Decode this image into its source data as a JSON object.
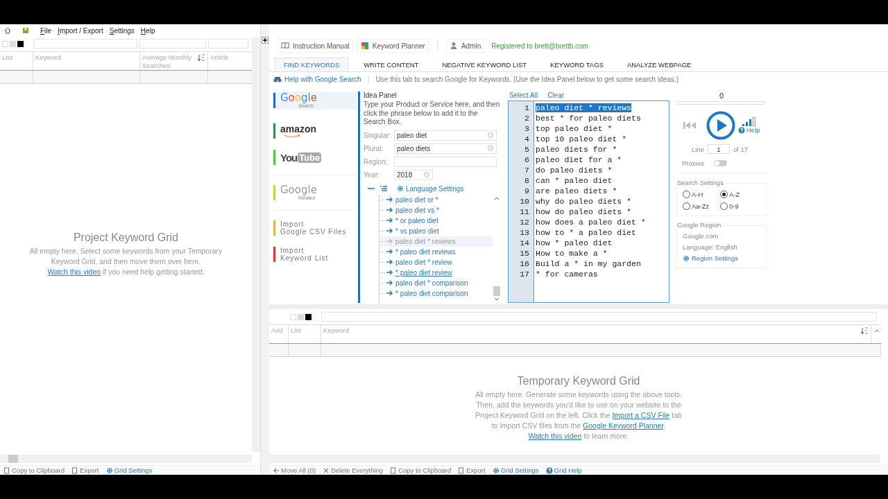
{
  "menu": [
    {
      "label": "File"
    },
    {
      "label": "Import / Export"
    },
    {
      "label": "Settings"
    },
    {
      "label": "Help"
    }
  ],
  "project_grid": {
    "columns": [
      "List",
      "Keyword",
      "Average Monthly Searches",
      "Article"
    ],
    "empty_title": "Project Keyword Grid",
    "empty_message": [
      {
        "kind": "text",
        "text": "All empty here. Select some keywords from your Temporary Keyword Grid, and then move them over here. "
      },
      {
        "kind": "link",
        "text": "Watch this video"
      },
      {
        "kind": "text",
        "text": " if you need help getting started."
      }
    ]
  },
  "project_footer": [
    {
      "label": "Copy to Clipboard",
      "kind": "plain"
    },
    {
      "label": "Export",
      "kind": "plain"
    },
    {
      "label": "Grid Settings",
      "kind": "link"
    }
  ],
  "toolbar": {
    "buttons": [
      "Instruction Manual",
      "Keyword Planner",
      "Admin"
    ],
    "registration": "Registered to brett@brettb.com"
  },
  "tabs": [
    {
      "label": "FIND KEYWORDS",
      "selected": true
    },
    {
      "label": "WRITE CONTENT",
      "selected": false
    },
    {
      "label": "NEGATIVE KEYWORD LIST",
      "selected": false
    },
    {
      "label": "KEYWORD TAGS",
      "selected": false
    },
    {
      "label": "ANALYZE WEBPAGE",
      "selected": false
    }
  ],
  "help_link": "Help with Google Search",
  "tab_hint": "Use this tab to search Google for Keywords. (Use the Idea Panel below to get some search ideas.)",
  "sources": [
    {
      "kind": "google",
      "label": "Google",
      "sublabel": "Search",
      "color": "#1e6fc4",
      "selected": true
    },
    {
      "kind": "amazon",
      "label": "amazon",
      "color": "#3c8a5a",
      "selected": false
    },
    {
      "kind": "youtube",
      "label": "You",
      "sublabel": "Tube",
      "color": "#4cc44c",
      "selected": false
    },
    {
      "kind": "related",
      "label": "Google",
      "sublabel": "Related",
      "color": "#b8d84a",
      "selected": false
    },
    {
      "kind": "import",
      "label": "Import",
      "sublabel": "Google CSV Files",
      "color": "#e8b450",
      "selected": false
    },
    {
      "kind": "import",
      "label": "Import",
      "sublabel": "Keyword List",
      "color": "#d43a3a",
      "selected": false
    }
  ],
  "idea_panel": {
    "title": "Idea Panel",
    "instructions": "Type your Product or Service here, and then click the phrase below to add it to the Search Box.",
    "fields": [
      {
        "kind": "text",
        "label": "Singular:",
        "value": "paleo diet"
      },
      {
        "kind": "text",
        "label": "Plural:",
        "value": "paleo diets"
      },
      {
        "kind": "text",
        "label": "Region:"
      },
      {
        "kind": "short",
        "label": "Year:",
        "value": "2018"
      }
    ],
    "language_settings": "Language Settings",
    "phrases": [
      {
        "text": "paleo diet or *",
        "used": false,
        "hovered": false
      },
      {
        "text": "paleo diet vs *",
        "used": false,
        "hovered": false
      },
      {
        "text": "* or paleo diet",
        "used": false,
        "hovered": false
      },
      {
        "text": "* vs paleo diet",
        "used": false,
        "hovered": false
      },
      {
        "text": "paleo diet * reviews",
        "used": true,
        "hovered": false
      },
      {
        "text": "* paleo diet reviews",
        "used": false,
        "hovered": false
      },
      {
        "text": "paleo diet * review",
        "used": false,
        "hovered": false
      },
      {
        "text": "* paleo diet review",
        "used": false,
        "hovered": true
      },
      {
        "text": "paleo diet * comparison",
        "used": false,
        "hovered": false
      },
      {
        "text": "* paleo diet comparison",
        "used": false,
        "hovered": false
      }
    ]
  },
  "keywords": {
    "select_all": "Select All",
    "clear": "Clear",
    "lines": [
      {
        "number": "1",
        "text": "paleo diet * reviews",
        "selected": true
      },
      {
        "number": "2",
        "text": "best * for paleo diets",
        "selected": false
      },
      {
        "number": "3",
        "text": "top paleo diet *",
        "selected": false
      },
      {
        "number": "4",
        "text": "top 10 paleo diet *",
        "selected": false
      },
      {
        "number": "5",
        "text": "paleo diets for *",
        "selected": false
      },
      {
        "number": "6",
        "text": "paleo diet for a *",
        "selected": false
      },
      {
        "number": "7",
        "text": "do paleo diets *",
        "selected": false
      },
      {
        "number": "8",
        "text": "can * paleo diet",
        "selected": false
      },
      {
        "number": "9",
        "text": "are paleo diets *",
        "selected": false
      },
      {
        "number": "10",
        "text": "why do paleo diets *",
        "selected": false
      },
      {
        "number": "11",
        "text": "how do paleo diets *",
        "selected": false
      },
      {
        "number": "12",
        "text": "how does a paleo diet *",
        "selected": false
      },
      {
        "number": "13",
        "text": "how to * a paleo diet",
        "selected": false
      },
      {
        "number": "14",
        "text": "how * paleo diet",
        "selected": false
      },
      {
        "number": "15",
        "text": "How to make a *",
        "selected": false
      },
      {
        "number": "16",
        "text": "Build a * in my garden",
        "selected": false
      },
      {
        "number": "17",
        "text": "* for cameras",
        "selected": false
      }
    ]
  },
  "runner": {
    "count": "0",
    "level": 0,
    "help": "Help",
    "line_label": "Line",
    "line_value": "1",
    "line_total": "of 17",
    "proxies_label": "Proxies",
    "proxies_on": false
  },
  "search_settings": {
    "title": "Search Settings",
    "options": [
      {
        "label": "A-H",
        "selected": false
      },
      {
        "label": "A-Z",
        "selected": true
      },
      {
        "label": "Aa-Zz",
        "selected": false
      },
      {
        "label": "0-9",
        "selected": false
      }
    ]
  },
  "google_region": {
    "title": "Google Region",
    "domain": "Google.com",
    "language": "Language: English",
    "settings_link": "Region Settings"
  },
  "temporary_grid": {
    "columns": [
      "Add",
      "List",
      "Keyword"
    ],
    "empty_title": "Temporary Keyword Grid",
    "empty_message": [
      {
        "kind": "text",
        "text": "All empty here. Generate some keywords using the above tools. Then, add the keywords you'd like to use on your website to the Project Keyword Grid on the left. Click the "
      },
      {
        "kind": "link",
        "text": "Import a CSV File"
      },
      {
        "kind": "text",
        "text": " tab to import CSV files from the "
      },
      {
        "kind": "link",
        "text": "Google Keyword Planner"
      },
      {
        "kind": "text",
        "text": ". "
      },
      {
        "kind": "link",
        "text": "Watch this video"
      },
      {
        "kind": "text",
        "text": " to learn more."
      }
    ]
  },
  "temporary_footer": [
    {
      "label": "Move All (0)",
      "kind": "plain"
    },
    {
      "label": "Delete Everything",
      "kind": "plain"
    },
    {
      "label": "Copy to Clipboard",
      "kind": "plain"
    },
    {
      "label": "Export",
      "kind": "plain"
    },
    {
      "label": "Grid Settings",
      "kind": "link"
    },
    {
      "label": "Grid Help",
      "kind": "link"
    }
  ]
}
